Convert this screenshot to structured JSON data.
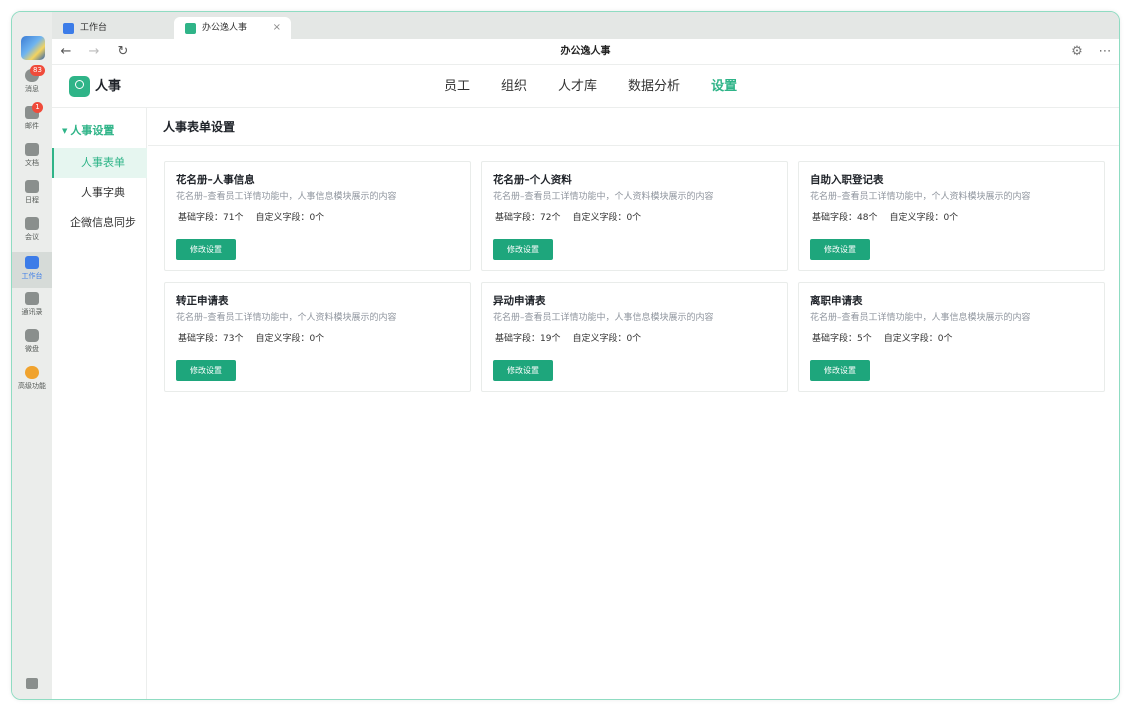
{
  "rail": {
    "items": [
      {
        "label": "消息",
        "badge": "83",
        "icon": "chat-icon"
      },
      {
        "label": "邮件",
        "badge": "1",
        "icon": "mail-icon"
      },
      {
        "label": "文档",
        "badge": "",
        "icon": "doc-icon"
      },
      {
        "label": "日程",
        "badge": "",
        "icon": "calendar-icon"
      },
      {
        "label": "会议",
        "badge": "",
        "icon": "meeting-icon"
      },
      {
        "label": "工作台",
        "badge": "",
        "icon": "workbench-icon",
        "active": true
      },
      {
        "label": "通讯录",
        "badge": "",
        "icon": "contacts-icon"
      },
      {
        "label": "微盘",
        "badge": "",
        "icon": "drive-icon"
      },
      {
        "label": "高级功能",
        "badge": "",
        "icon": "advanced-icon"
      }
    ]
  },
  "tabs": [
    {
      "label": "工作台",
      "icon": "workbench-icon",
      "color": "#3c7ce8"
    },
    {
      "label": "办公逸人事",
      "icon": "hr-app-icon",
      "color": "#2fb488",
      "close": "×"
    }
  ],
  "navbar": {
    "title": "办公逸人事",
    "back": "←",
    "forward": "→",
    "reload": "↻",
    "settings": "⚙",
    "more": "⋯"
  },
  "app": {
    "name": "人事",
    "accent": "#2fb488"
  },
  "topnav": [
    "员工",
    "组织",
    "人才库",
    "数据分析",
    "设置"
  ],
  "topnav_active": "设置",
  "sidebar": {
    "group": "人事设置",
    "items": [
      "人事表单",
      "人事字典",
      "企微信息同步"
    ],
    "active": "人事表单"
  },
  "page": {
    "title": "人事表单设置"
  },
  "cards": [
    {
      "title": "花名册–人事信息",
      "desc": "花名册–查看员工详情功能中，人事信息模块展示的内容",
      "base": "基础字段：71个",
      "custom": "自定义字段：0个",
      "button": "修改设置"
    },
    {
      "title": "花名册–个人资料",
      "desc": "花名册–查看员工详情功能中，个人资料模块展示的内容",
      "base": "基础字段：72个",
      "custom": "自定义字段：0个",
      "button": "修改设置"
    },
    {
      "title": "自助入职登记表",
      "desc": "花名册–查看员工详情功能中，个人资料模块展示的内容",
      "base": "基础字段：48个",
      "custom": "自定义字段：0个",
      "button": "修改设置"
    },
    {
      "title": "转正申请表",
      "desc": "花名册–查看员工详情功能中，个人资料模块展示的内容",
      "base": "基础字段：73个",
      "custom": "自定义字段：0个",
      "button": "修改设置"
    },
    {
      "title": "异动申请表",
      "desc": "花名册–查看员工详情功能中，人事信息模块展示的内容",
      "base": "基础字段：19个",
      "custom": "自定义字段：0个",
      "button": "修改设置"
    },
    {
      "title": "离职申请表",
      "desc": "花名册–查看员工详情功能中，人事信息模块展示的内容",
      "base": "基础字段：5个",
      "custom": "自定义字段：0个",
      "button": "修改设置"
    }
  ]
}
